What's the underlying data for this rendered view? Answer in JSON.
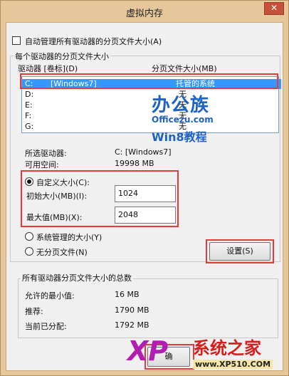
{
  "window": {
    "title": "虚拟内存",
    "close_glyph": "✕"
  },
  "auto_manage": {
    "label": "自动管理所有驱动器的分页文件大小(A)",
    "checked": false
  },
  "drives_group": {
    "title": "每个驱动器的分页文件大小",
    "col_drive": "驱动器 [卷标](D)",
    "col_size": "分页文件大小(MB)",
    "rows": [
      {
        "drive": "C:",
        "label": "[Windows7]",
        "size": "托管的系统",
        "selected": true
      },
      {
        "drive": "D:",
        "label": "",
        "size": "无",
        "selected": false
      },
      {
        "drive": "E:",
        "label": "",
        "size": "无",
        "selected": false
      },
      {
        "drive": "F:",
        "label": "",
        "size": "无",
        "selected": false
      },
      {
        "drive": "G:",
        "label": "",
        "size": "无",
        "selected": false
      }
    ]
  },
  "selected_drive": {
    "label": "所选驱动器:",
    "value": "C:  [Windows7]",
    "space_label": "可用空间:",
    "space_value": "19998 MB"
  },
  "custom": {
    "radio_label": "自定义大小(C):",
    "initial_label": "初始大小(MB)(I):",
    "initial_value": "1024",
    "max_label": "最大值(MB)(X):",
    "max_value": "2048"
  },
  "system_managed": {
    "label": "系统管理的大小(Y)"
  },
  "no_paging": {
    "label": "无分页文件(N)"
  },
  "set_button": {
    "label": "设置(S)"
  },
  "totals_group": {
    "title": "所有驱动器分页文件大小的总数",
    "min_label": "允许的最小值:",
    "min_value": "16 MB",
    "recommended_label": "推荐:",
    "recommended_value": "1790 MB",
    "current_label": "当前已分配:",
    "current_value": "1792 MB"
  },
  "ok_button": {
    "label": "确"
  },
  "watermarks": {
    "ban": "办公族",
    "site": "Officezu.com",
    "w8": "Win8教程",
    "xp_logo": "XP",
    "xp_cn": "系统之家",
    "xp_url": "www.XP510.COM"
  }
}
